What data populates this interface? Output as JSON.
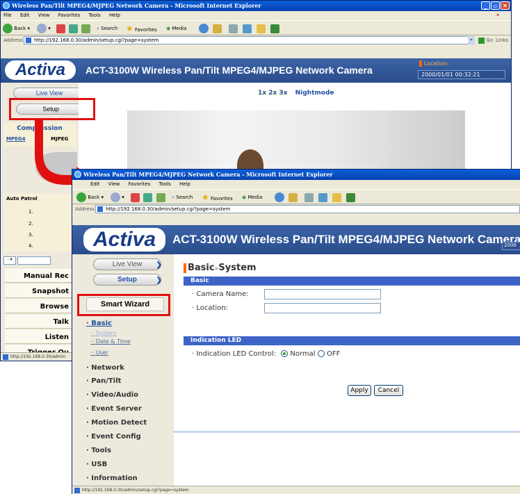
{
  "back_window": {
    "title": "Wireless Pan/Tilt MPEG4/MJPEG Network Camera - Microsoft Internet Explorer",
    "menu": [
      "File",
      "Edit",
      "View",
      "Favorites",
      "Tools",
      "Help"
    ],
    "toolbar": {
      "back": "Back",
      "search": "Search",
      "favorites": "Favorites",
      "media": "Media"
    },
    "address_label": "Address",
    "address": "http://192.168.0.30/admin/setup.cgi?page=system",
    "go_label": "Go",
    "links_label": "Links",
    "logo": "Activa",
    "banner_title": "ACT-3100W Wireless Pan/Tilt MPEG4/MJPEG Network Camera",
    "location_label": "Location:",
    "datetime": "2000/01/01 00:32:21",
    "live_view": "Live View",
    "setup": "Setup",
    "zoom_options": "1x 2x 3x",
    "nightmode": "Nightmode",
    "compression_title": "Compression",
    "codecs": [
      "MPEG4",
      "MJPEG"
    ],
    "auto_patrol": "Auto Patrol",
    "patrol_items": [
      "1.",
      "2.",
      "3.",
      "4."
    ],
    "buttons": [
      "Manual Rec",
      "Snapshot",
      "Browse",
      "Talk",
      "Listen",
      "Trigger Ou"
    ],
    "status_url": "http://192.168.0.30/admin"
  },
  "front_window": {
    "title": "Wireless Pan/Tilt MPEG4/MJPEG Network Camera - Microsoft Internet Explorer",
    "menu": [
      "Edit",
      "View",
      "Favorites",
      "Tools",
      "Help"
    ],
    "toolbar": {
      "back": "Back",
      "search": "Search",
      "favorites": "Favorites",
      "media": "Media"
    },
    "address_label": "Address",
    "address": "http://192.168.0.30/admin/setup.cgi?page=system",
    "logo": "Activa",
    "banner_title": "ACT-3100W Wireless Pan/Tilt MPEG4/MJPEG Network Camera",
    "banner_right_frag": "2000",
    "live_view": "Live View",
    "setup": "Setup",
    "smart_wizard": "Smart Wizard",
    "nav": {
      "basic": "Basic",
      "sub_items": [
        "System",
        "Date & Time",
        "User"
      ],
      "items": [
        "Network",
        "Pan/Tilt",
        "Video/Audio",
        "Event Server",
        "Motion Detect",
        "Event Config",
        "Tools",
        "USB",
        "Information"
      ]
    },
    "page_title_main": "Basic",
    "page_title_sep": "»",
    "page_title_sub": "System",
    "section_basic": "Basic",
    "camera_name_label": "· Camera Name:",
    "camera_name_value": "",
    "location_label": "· Location:",
    "location_value": "",
    "section_led": "Indication LED",
    "led_label": "· Indication LED Control:",
    "led_normal": "Normal",
    "led_off": "OFF",
    "led_selected": "Normal",
    "apply": "Apply",
    "cancel": "Cancel",
    "status_url": "http://192.168.0.30/admin/setup.cgi?page=system"
  },
  "colors": {
    "highlight": "#e01010",
    "banner": "#2a4d8c",
    "section_bar": "#3d63c6",
    "arrow": "#e01010"
  }
}
